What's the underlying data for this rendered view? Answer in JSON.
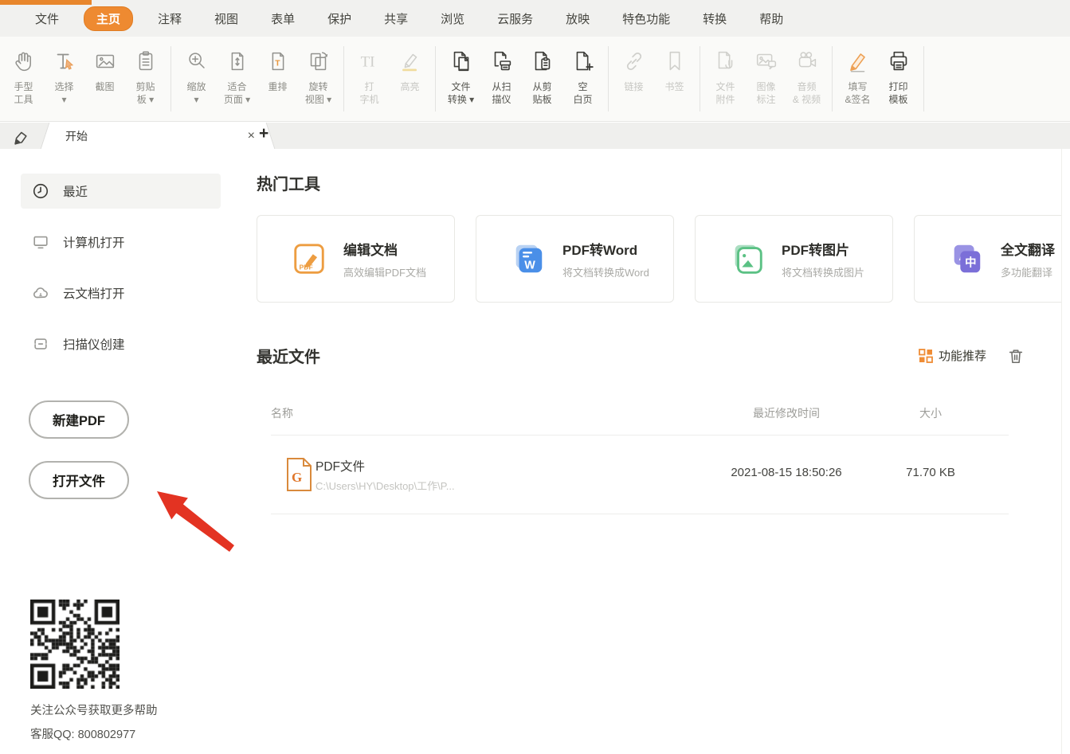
{
  "colors": {
    "accent_orange": "#EE8A31",
    "arrow_red": "#E33322",
    "card_orange": "#ED9D41",
    "card_blue": "#4A8FE8",
    "card_green": "#5BC184",
    "card_purple": "#7B6FD8"
  },
  "menu": {
    "items": [
      {
        "label": "文件"
      },
      {
        "label": "主页",
        "active": true
      },
      {
        "label": "注释"
      },
      {
        "label": "视图"
      },
      {
        "label": "表单"
      },
      {
        "label": "保护"
      },
      {
        "label": "共享"
      },
      {
        "label": "浏览"
      },
      {
        "label": "云服务"
      },
      {
        "label": "放映"
      },
      {
        "label": "特色功能"
      },
      {
        "label": "转换"
      },
      {
        "label": "帮助"
      }
    ]
  },
  "toolbar": {
    "items": [
      {
        "label": "手型\n工具",
        "icon": "hand-icon",
        "state": "normal"
      },
      {
        "label": "选择\n▾",
        "icon": "select-icon",
        "state": "normal"
      },
      {
        "label": "截图",
        "icon": "snapshot-icon",
        "state": "normal"
      },
      {
        "label": "剪贴\n板 ▾",
        "icon": "clipboard-icon",
        "state": "normal"
      },
      {
        "label": "缩放\n▾",
        "icon": "zoom-icon",
        "state": "normal"
      },
      {
        "label": "适合\n页面 ▾",
        "icon": "fit-page-icon",
        "state": "normal"
      },
      {
        "label": "重排",
        "icon": "reflow-icon",
        "state": "normal"
      },
      {
        "label": "旋转\n视图 ▾",
        "icon": "rotate-view-icon",
        "state": "normal"
      },
      {
        "label": "打\n字机",
        "icon": "typewriter-icon",
        "state": "disabled"
      },
      {
        "label": "高亮",
        "icon": "highlight-icon",
        "state": "disabled"
      },
      {
        "label": "文件\n转换 ▾",
        "icon": "file-convert-icon",
        "state": "dark"
      },
      {
        "label": "从扫\n描仪",
        "icon": "from-scanner-icon",
        "state": "dark"
      },
      {
        "label": "从剪\n贴板",
        "icon": "from-clipboard-icon",
        "state": "dark"
      },
      {
        "label": "空\n白页",
        "icon": "blank-page-icon",
        "state": "dark"
      },
      {
        "label": "链接",
        "icon": "link-icon",
        "state": "disabled"
      },
      {
        "label": "书签",
        "icon": "bookmark-icon",
        "state": "disabled"
      },
      {
        "label": "文件\n附件",
        "icon": "attachment-icon",
        "state": "disabled"
      },
      {
        "label": "图像\n标注",
        "icon": "image-annotation-icon",
        "state": "disabled"
      },
      {
        "label": "音频\n& 视频",
        "icon": "audio-video-icon",
        "state": "disabled"
      },
      {
        "label": "填写\n&签名",
        "icon": "fill-sign-icon",
        "state": "normal"
      },
      {
        "label": "打印\n模板",
        "icon": "print-template-icon",
        "state": "dark"
      }
    ]
  },
  "tabbar": {
    "tab_label": "开始",
    "close_label": "×",
    "add_label": "+"
  },
  "sidebar": {
    "items": [
      {
        "label": "最近",
        "icon": "clock-icon",
        "active": true
      },
      {
        "label": "计算机打开",
        "icon": "computer-icon"
      },
      {
        "label": "云文档打开",
        "icon": "cloud-icon"
      },
      {
        "label": "扫描仪创建",
        "icon": "scanner-icon"
      }
    ],
    "new_pdf": "新建PDF",
    "open_file": "打开文件",
    "qr_caption": "关注公众号获取更多帮助",
    "qq_line": "客服QQ: 800802977"
  },
  "main": {
    "hot_tools": {
      "title": "热门工具",
      "cards": [
        {
          "title": "编辑文档",
          "subtitle": "高效编辑PDF文档",
          "color": "#ED9D41"
        },
        {
          "title": "PDF转Word",
          "subtitle": "将文档转换成Word",
          "color": "#4A8FE8"
        },
        {
          "title": "PDF转图片",
          "subtitle": "将文档转换成图片",
          "color": "#5BC184"
        },
        {
          "title": "全文翻译",
          "subtitle": "多功能翻译",
          "color": "#7B6FD8"
        }
      ]
    },
    "recent": {
      "title": "最近文件",
      "recommend_label": "功能推荐",
      "columns": [
        "名称",
        "最近修改时间",
        "大小"
      ],
      "files": [
        {
          "name": "PDF文件",
          "path": "C:\\Users\\HY\\Desktop\\工作\\P...",
          "time": "2021-08-15 18:50:26",
          "size": "71.70 KB"
        }
      ]
    }
  }
}
